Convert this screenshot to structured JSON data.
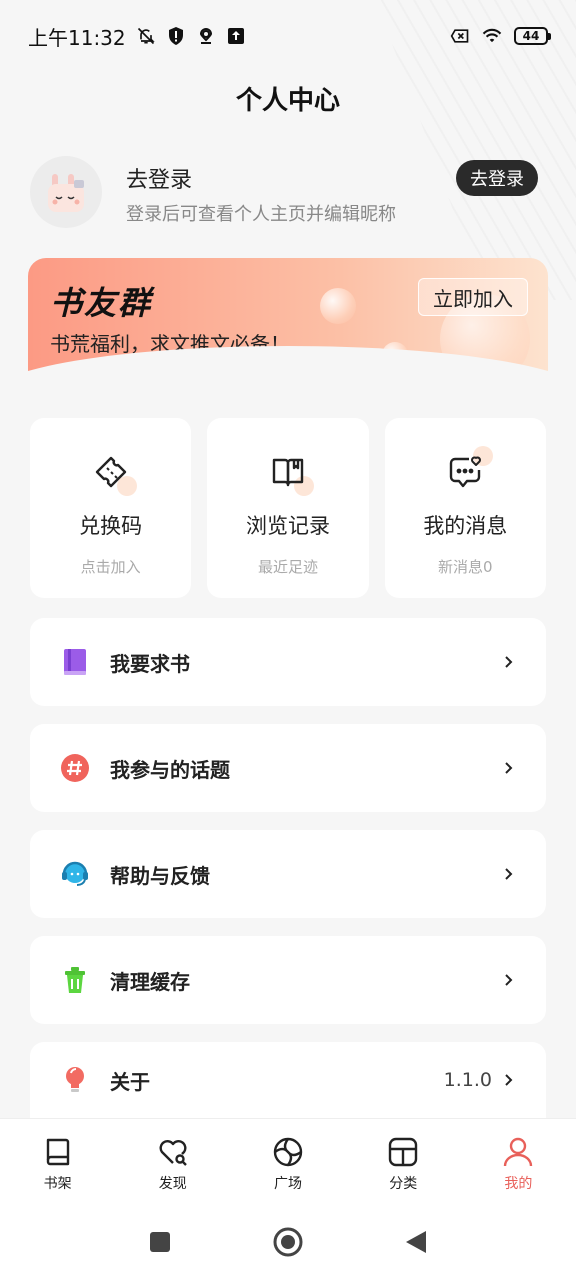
{
  "status_bar": {
    "time": "上午11:32",
    "battery": "44",
    "icons": [
      "mute-icon",
      "shield-icon",
      "location-icon",
      "upload-icon",
      "sim-off-icon",
      "wifi-icon",
      "battery-icon"
    ]
  },
  "header": {
    "title": "个人中心"
  },
  "profile": {
    "name": "去登录",
    "subtitle": "登录后可查看个人主页并编辑昵称",
    "login_button": "去登录"
  },
  "banner": {
    "title": "书友群",
    "subtitle": "书荒福利，求文推文必备！",
    "join_button": "立即加入"
  },
  "quick_actions": [
    {
      "label": "兑换码",
      "sub": "点击加入",
      "icon": "ticket-icon"
    },
    {
      "label": "浏览记录",
      "sub": "最近足迹",
      "icon": "book-open-icon"
    },
    {
      "label": "我的消息",
      "sub": "新消息0",
      "icon": "message-icon"
    }
  ],
  "menu": [
    {
      "label": "我要求书",
      "icon": "book-request-icon",
      "value": ""
    },
    {
      "label": "我参与的话题",
      "icon": "hashtag-icon",
      "value": ""
    },
    {
      "label": "帮助与反馈",
      "icon": "support-icon",
      "value": ""
    },
    {
      "label": "清理缓存",
      "icon": "trash-icon",
      "value": ""
    },
    {
      "label": "关于",
      "icon": "bulb-icon",
      "value": "1.1.0"
    }
  ],
  "bottom_nav": [
    {
      "label": "书架",
      "icon": "bookshelf-icon",
      "active": false
    },
    {
      "label": "发现",
      "icon": "discover-icon",
      "active": false
    },
    {
      "label": "广场",
      "icon": "plaza-icon",
      "active": false
    },
    {
      "label": "分类",
      "icon": "category-icon",
      "active": false
    },
    {
      "label": "我的",
      "icon": "profile-icon",
      "active": true
    }
  ],
  "colors": {
    "accent": "#e8605a",
    "background": "#f6f6f6",
    "banner_start": "#fc9a84",
    "banner_end": "#fde3cf"
  }
}
